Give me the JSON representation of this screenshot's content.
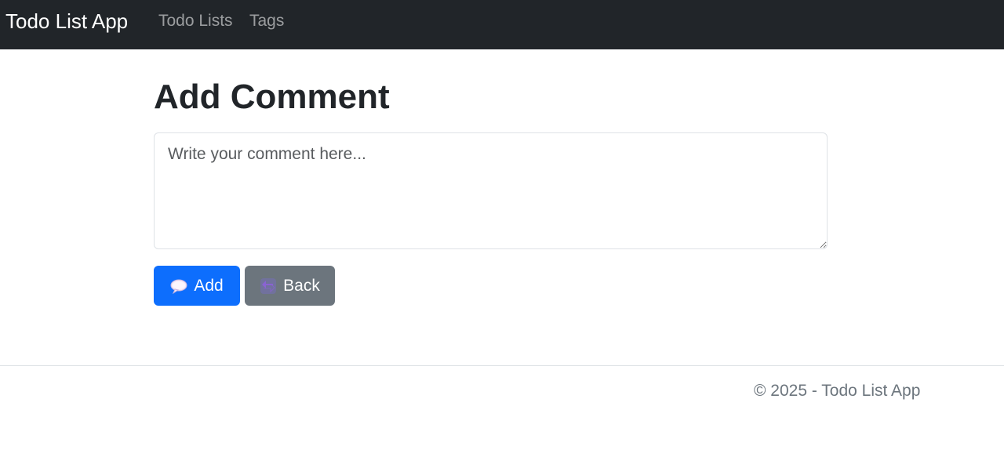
{
  "navbar": {
    "brand": "Todo List App",
    "links": [
      {
        "label": "Todo Lists"
      },
      {
        "label": "Tags"
      }
    ]
  },
  "main": {
    "title": "Add Comment",
    "comment_field": {
      "placeholder": "Write your comment here...",
      "value": ""
    },
    "buttons": {
      "add_label": "Add",
      "back_label": "Back"
    }
  },
  "footer": {
    "text": "© 2025 - Todo List App"
  },
  "icons": {
    "add": "speech-bubble-icon",
    "back": "back-arrow-icon"
  },
  "colors": {
    "navbar": "#212529",
    "primary": "#0d6efd",
    "secondary": "#6c757d"
  }
}
